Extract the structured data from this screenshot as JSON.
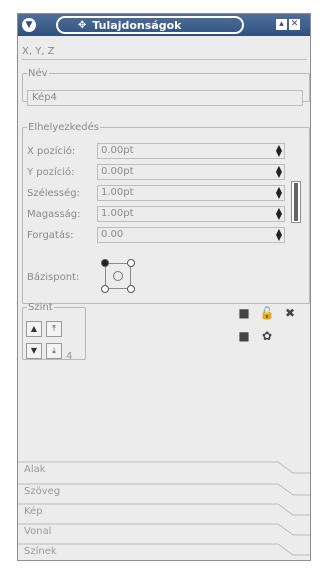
{
  "window": {
    "title": "Tulajdonságok",
    "menu_icon": "chevron-down-icon",
    "app_icon": "properties-icon",
    "shade_icon": "shade-icon",
    "close_icon": "close-icon"
  },
  "xyz_section": {
    "label": "X, Y, Z"
  },
  "name_group": {
    "legend": "Név",
    "value": "Kép4"
  },
  "position_group": {
    "legend": "Elhelyezkedés",
    "rows": [
      {
        "label": "X pozíció:",
        "value": "0.00pt"
      },
      {
        "label": "Y pozíció:",
        "value": "0.00pt"
      },
      {
        "label": "Szélesség:",
        "value": "1.00pt"
      },
      {
        "label": "Magasság:",
        "value": "1.00pt"
      },
      {
        "label": "Forgatás:",
        "value": "0.00"
      }
    ],
    "basepoint_label": "Bázispont:"
  },
  "level_group": {
    "legend": "Szint",
    "value": "4"
  },
  "sections": [
    {
      "label": "Alak"
    },
    {
      "label": "Szöveg"
    },
    {
      "label": "Kép"
    },
    {
      "label": "Vonal"
    },
    {
      "label": "Színek"
    }
  ],
  "colors": {
    "titlebar": "#3f5f8c",
    "panel_bg": "#ececec",
    "disabled_text": "#8a8a8a"
  }
}
